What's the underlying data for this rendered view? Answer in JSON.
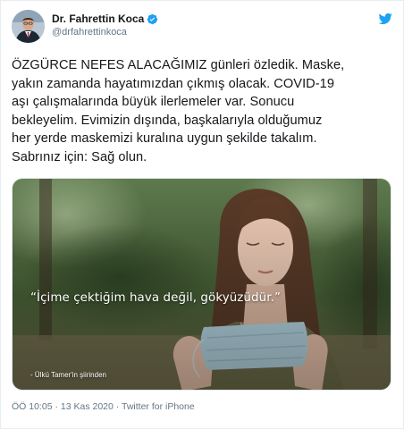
{
  "author": {
    "display_name": "Dr. Fahrettin Koca",
    "handle": "@drfahrettinkoca",
    "verified": true
  },
  "tweet": {
    "text": "ÖZGÜRCE NEFES ALACAĞIMIZ günleri özledik. Maske,\nyakın zamanda hayatımızdan çıkmış olacak. COVID-19\naşı çalışmalarında büyük ilerlemeler var. Sonucu\nbekleyelim. Evimizin dışında, başkalarıyla olduğumuz\nher yerde maskemizi kuralına uygun şekilde takalım.\nSabrınız için: Sağ olun."
  },
  "media": {
    "quote": "“İçime çektiğim hava değil, gökyüzüdür.”",
    "attribution": "- Ülkü Tamer'in şiirinden"
  },
  "meta": {
    "time": "ÖÖ 10:05",
    "separator1": "·",
    "date": "13 Kas 2020",
    "separator2": "·",
    "source": "Twitter for iPhone"
  },
  "icons": {
    "verified": "verified-badge-icon",
    "brand": "twitter-bird-icon"
  },
  "colors": {
    "brand": "#1da1f2",
    "text": "#14171a",
    "muted": "#657786"
  }
}
